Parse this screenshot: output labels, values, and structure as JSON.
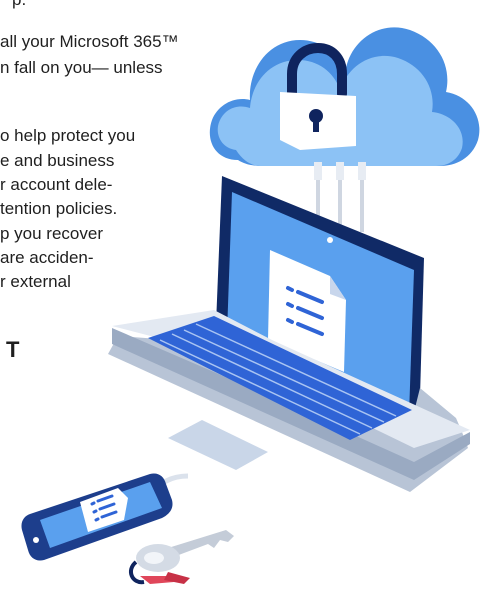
{
  "text_lines": [
    "p.",
    "all your Microsoft 365™",
    "n fall on you— unless",
    "o help protect you",
    "e and business",
    "r account dele-",
    "tention policies.",
    "p you recover",
    "are acciden-",
    "r external"
  ],
  "heading_fragment": "T",
  "colors": {
    "cloud": "#4a90e2",
    "cloud_light": "#8cc2f5",
    "screen": "#5aa0ee",
    "laptop_body": "#d9e1ec",
    "keys": "#2f64d6",
    "dark_frame": "#102a66",
    "phone": "#1d3e8c",
    "key_ribbon": "#e0465a"
  },
  "icons": [
    "cloud-icon",
    "padlock-icon",
    "document-icon",
    "key-icon"
  ]
}
